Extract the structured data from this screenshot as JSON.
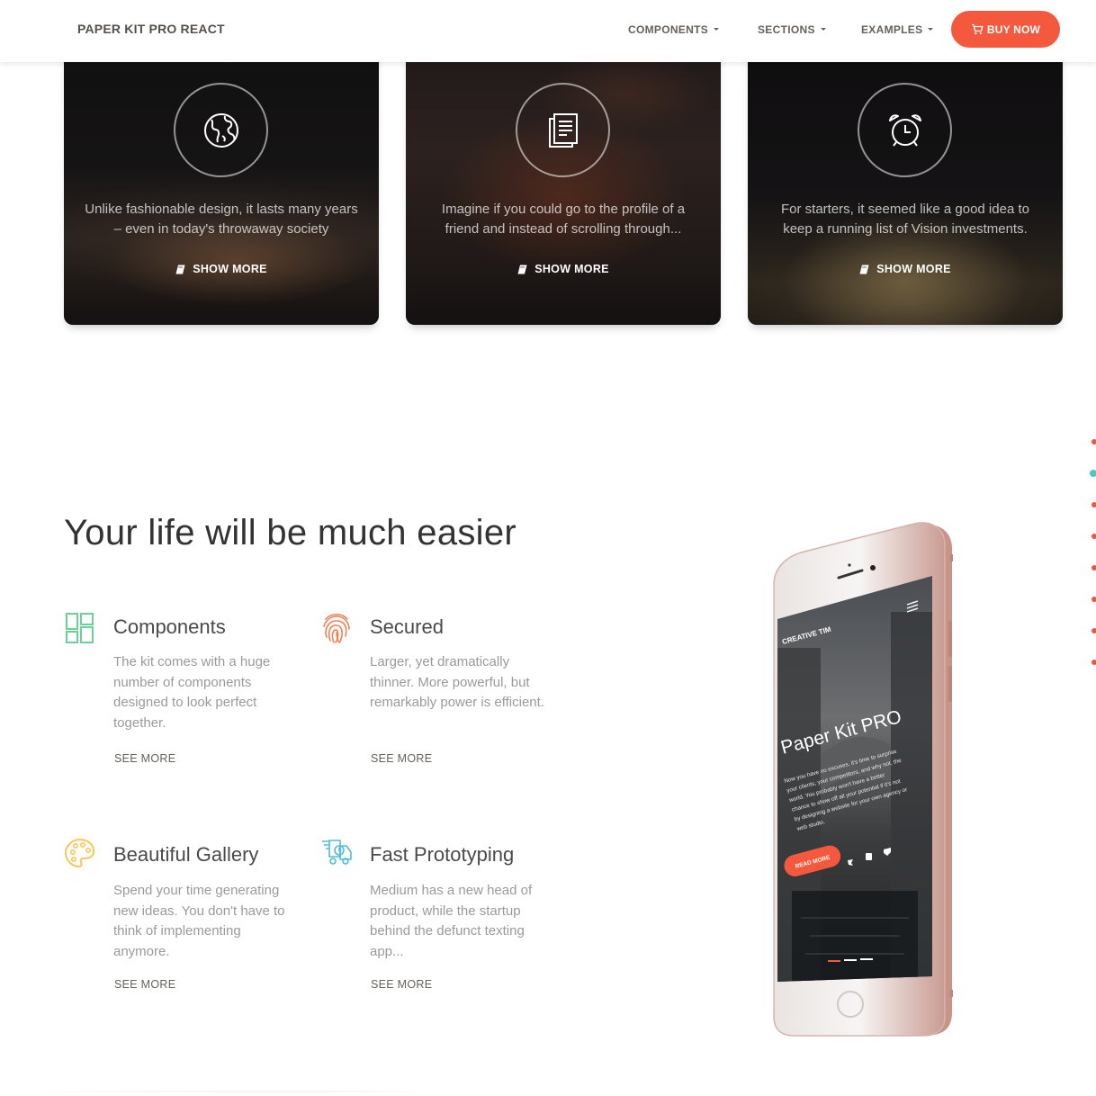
{
  "navbar": {
    "brand": "PAPER KIT PRO REACT",
    "items": [
      {
        "label": "COMPONENTS"
      },
      {
        "label": "SECTIONS"
      },
      {
        "label": "EXAMPLES"
      }
    ],
    "buy_label": "BUY NOW",
    "buy_icon": "cart-icon",
    "accent_color": "#f5593d"
  },
  "cards": [
    {
      "icon": "globe-icon",
      "text": "Unlike fashionable design, it lasts many years – even in today's throwaway society",
      "link": "SHOW MORE",
      "link_icon": "book-icon"
    },
    {
      "icon": "paper-icon",
      "text": "Imagine if you could go to the profile of a friend and instead of scrolling through...",
      "link": "SHOW MORE",
      "link_icon": "book-icon"
    },
    {
      "icon": "alarm-clock-icon",
      "text": "For starters, it seemed like a good idea to keep a running list of Vision investments.",
      "link": "SHOW MORE",
      "link_icon": "book-icon"
    }
  ],
  "features_section": {
    "title": "Your life will be much easier",
    "features": [
      {
        "icon": "layout-grid-icon",
        "icon_color": "#6bd098",
        "title": "Components",
        "description": "The kit comes with a huge number of components designed to look perfect together.",
        "link": "SEE MORE"
      },
      {
        "icon": "fingerprint-icon",
        "icon_color": "#ef8157",
        "title": "Secured",
        "description": "Larger, yet dramatically thinner. More powerful, but remarkably power is efficient.",
        "link": "SEE MORE"
      },
      {
        "icon": "palette-icon",
        "icon_color": "#fbc658",
        "title": "Beautiful Gallery",
        "description": "Spend your time generating new ideas. You don't have to think of implementing anymore.",
        "link": "SEE MORE"
      },
      {
        "icon": "delivery-truck-icon",
        "icon_color": "#51bcda",
        "title": "Fast Prototyping",
        "description": "Medium has a new head of product, while the startup behind the defunct texting app...",
        "link": "SEE MORE"
      }
    ]
  },
  "phone": {
    "brand": "CREATIVE TIM",
    "title": "Paper Kit PRO",
    "body": "Now you have no excuses, it's time to surprise your clients, your competitors, and why not, the world. You probably won't have a better chance to show off all your potential if it's not by designing a website for your own agency or web studio.",
    "button": "READ MORE"
  },
  "side_nav": {
    "active_index": 1,
    "dot_color": "#e8593b",
    "active_color": "#4ec6c5"
  }
}
